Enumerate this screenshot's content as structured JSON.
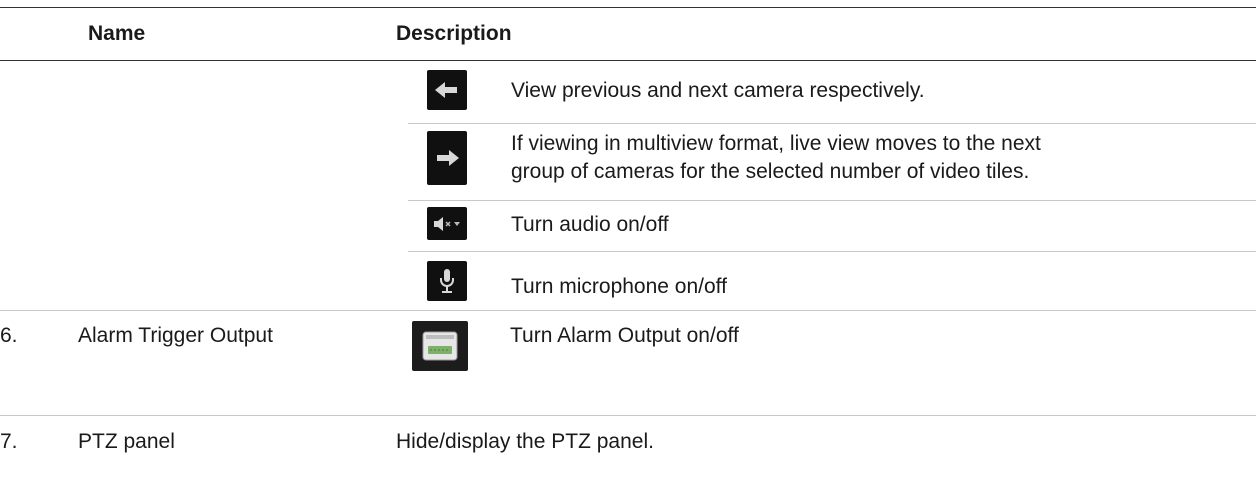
{
  "header": {
    "name_label": "Name",
    "description_label": "Description"
  },
  "icon_rows": [
    {
      "icon": "arrow-left-icon",
      "text": "View previous and next camera respectively."
    },
    {
      "icon": "arrow-right-icon",
      "text_lines": [
        "If viewing in multiview format, live view moves to the next",
        "group of cameras for the selected number of video tiles."
      ]
    },
    {
      "icon": "speaker-mute-icon",
      "text": "Turn audio on/off"
    },
    {
      "icon": "microphone-icon",
      "text": "Turn microphone on/off"
    }
  ],
  "numbered_rows": [
    {
      "number": "6.",
      "name": "Alarm Trigger Output",
      "icon": "alarm-output-icon",
      "description": "Turn Alarm Output on/off"
    },
    {
      "number": "7.",
      "name": "PTZ panel",
      "description": "Hide/display the PTZ panel."
    }
  ],
  "colors": {
    "rule_dark": "#333333",
    "rule_light": "#c8c8c8",
    "icon_bg": "#101010"
  }
}
